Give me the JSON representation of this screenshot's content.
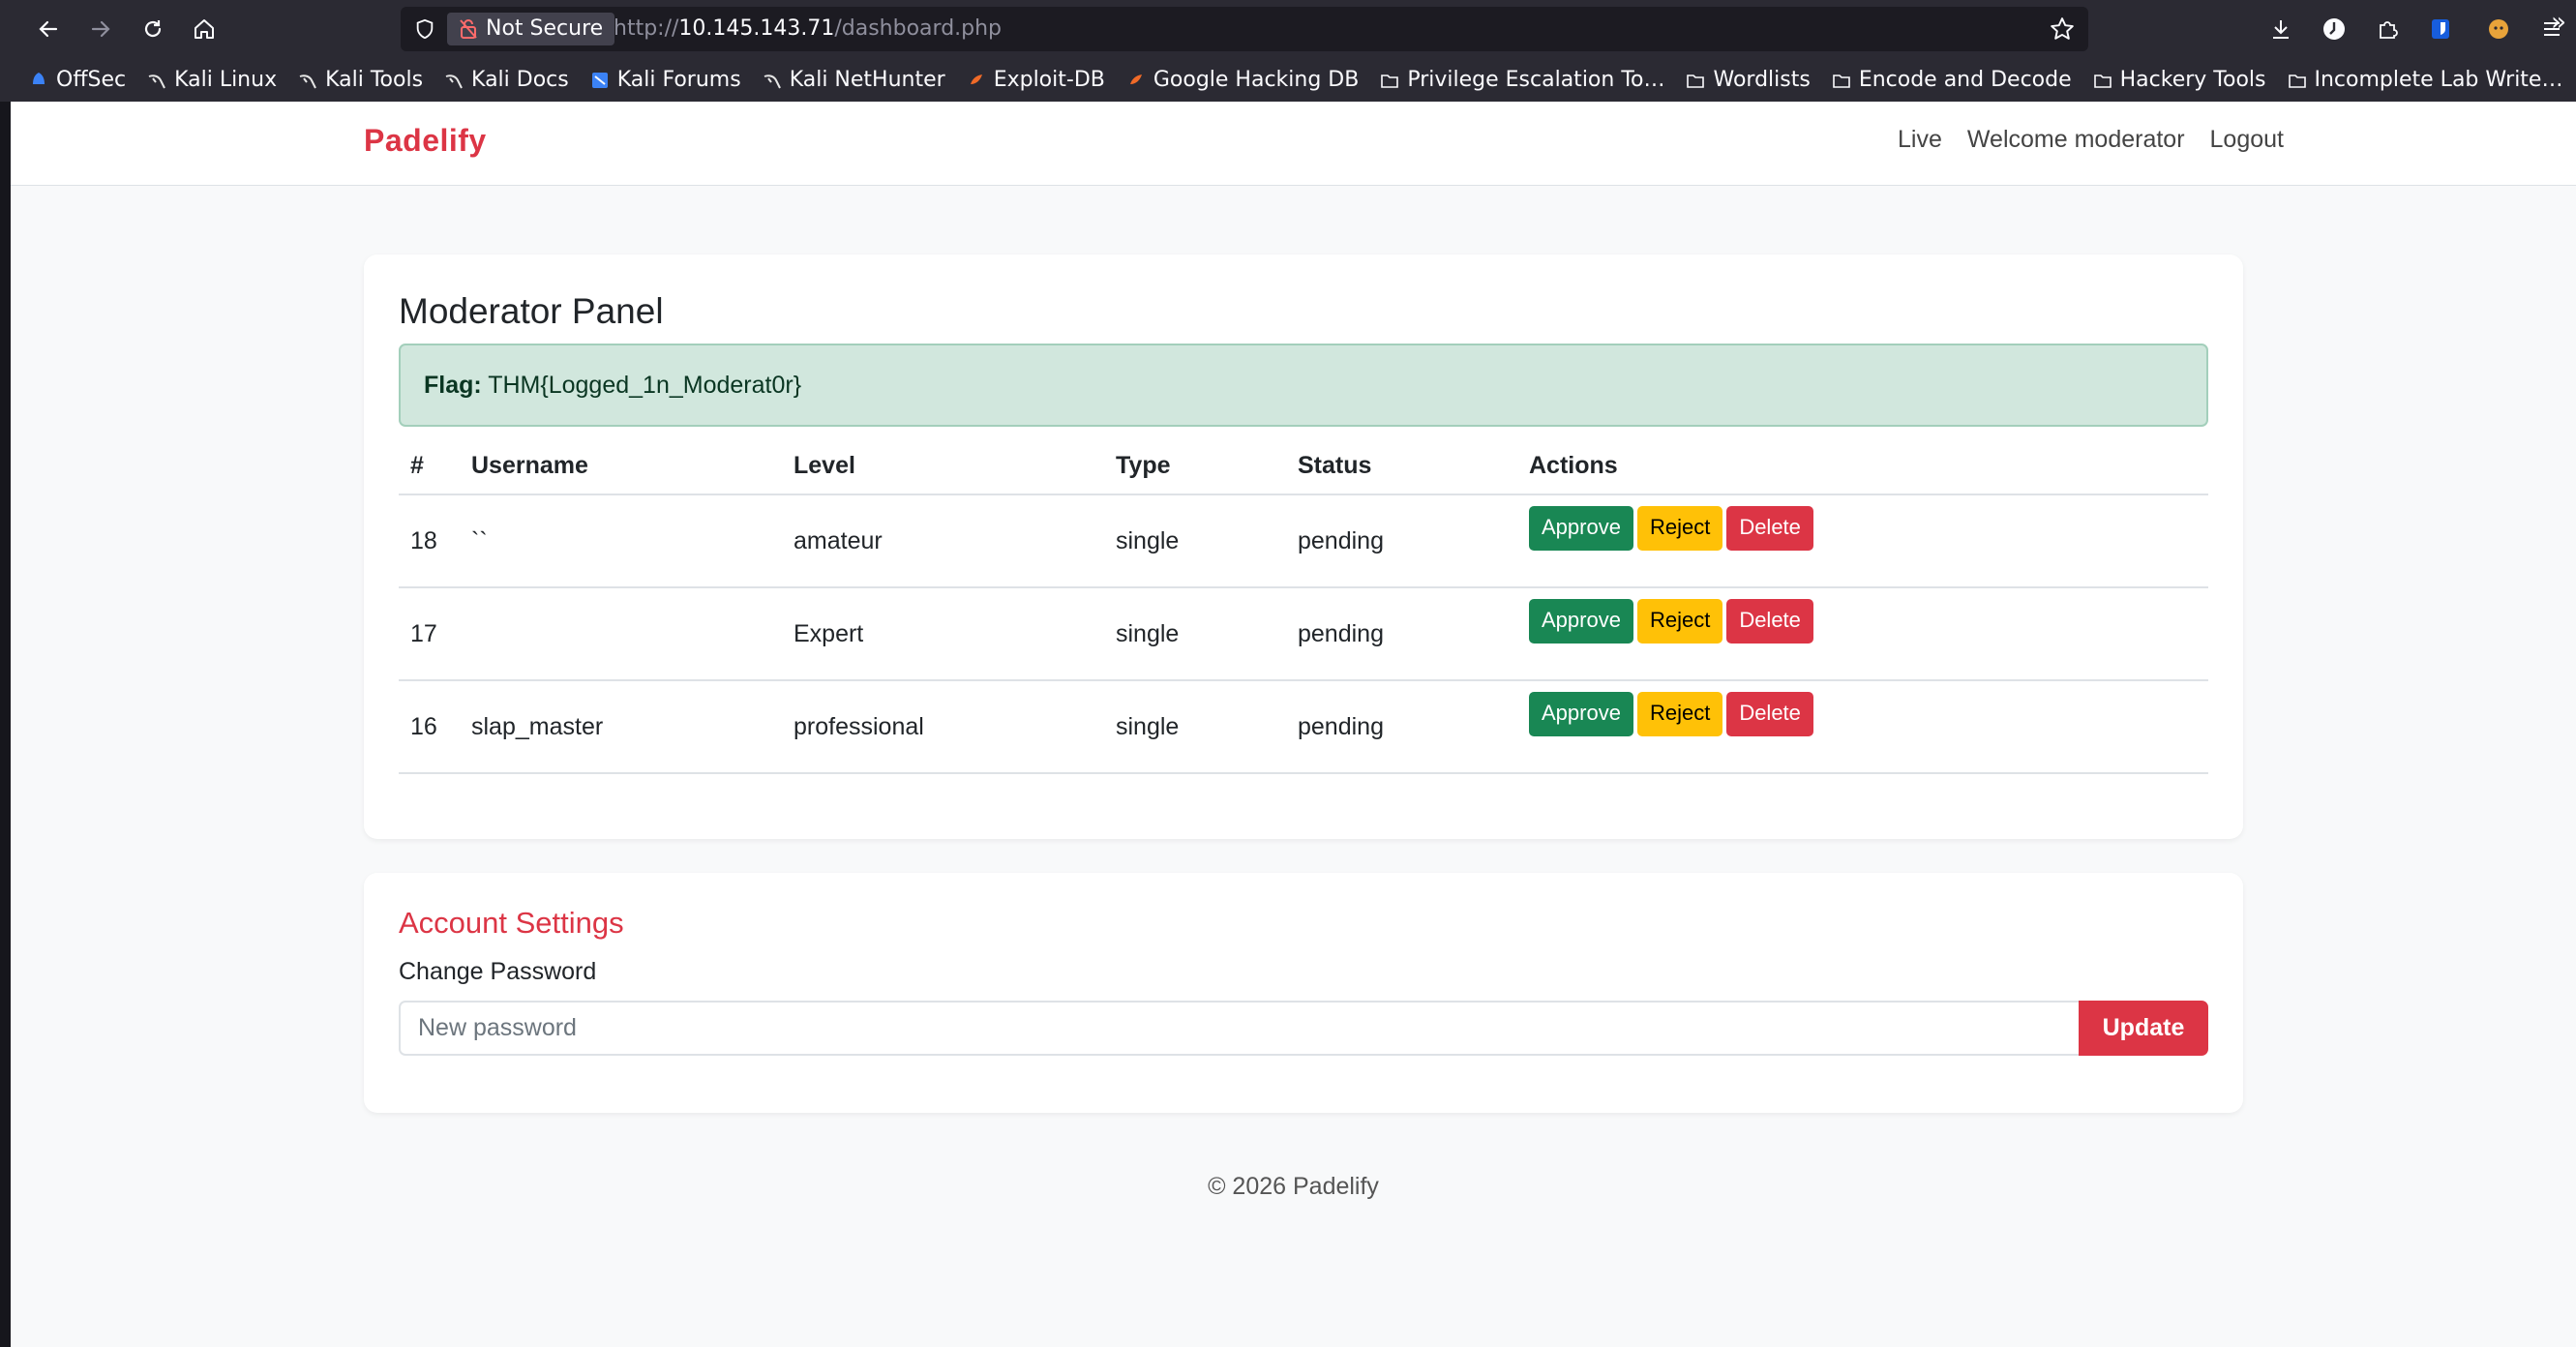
{
  "browser": {
    "security_label": "Not Secure",
    "url_prefix": "http://",
    "url_host": "10.145.143.71",
    "url_path": "/dashboard.php",
    "bookmarks": [
      {
        "label": "OffSec",
        "icon": "offsec-icon"
      },
      {
        "label": "Kali Linux",
        "icon": "kali-dragon-icon"
      },
      {
        "label": "Kali Tools",
        "icon": "kali-dragon-icon"
      },
      {
        "label": "Kali Docs",
        "icon": "kali-dragon-icon"
      },
      {
        "label": "Kali Forums",
        "icon": "kali-forums-icon"
      },
      {
        "label": "Kali NetHunter",
        "icon": "kali-dragon-icon"
      },
      {
        "label": "Exploit-DB",
        "icon": "exploitdb-icon"
      },
      {
        "label": "Google Hacking DB",
        "icon": "exploitdb-icon"
      },
      {
        "label": "Privilege Escalation To…",
        "icon": "folder-icon"
      },
      {
        "label": "Wordlists",
        "icon": "folder-icon"
      },
      {
        "label": "Encode and Decode",
        "icon": "folder-icon"
      },
      {
        "label": "Hackery Tools",
        "icon": "folder-icon"
      },
      {
        "label": "Incomplete Lab Write…",
        "icon": "folder-icon"
      }
    ]
  },
  "nav": {
    "brand": "Padelify",
    "live": "Live",
    "welcome": "Welcome moderator",
    "logout": "Logout"
  },
  "panel": {
    "title": "Moderator Panel",
    "flag_label": "Flag:",
    "flag_value": "THM{Logged_1n_Moderat0r}",
    "columns": [
      "#",
      "Username",
      "Level",
      "Type",
      "Status",
      "Actions"
    ],
    "rows": [
      {
        "id": "18",
        "username": "``",
        "level": "amateur",
        "type": "single",
        "status": "pending"
      },
      {
        "id": "17",
        "username": "",
        "level": "Expert",
        "type": "single",
        "status": "pending"
      },
      {
        "id": "16",
        "username": "slap_master",
        "level": "professional",
        "type": "single",
        "status": "pending"
      }
    ],
    "actions": {
      "approve": "Approve",
      "reject": "Reject",
      "delete": "Delete"
    }
  },
  "account": {
    "title": "Account Settings",
    "change_password_label": "Change Password",
    "password_placeholder": "New password",
    "update_label": "Update"
  },
  "footer": "© 2026 Padelify",
  "colors": {
    "brand": "#dc3545",
    "approve": "#198754",
    "reject": "#ffc107",
    "delete": "#dc3545",
    "flag_bg": "#d1e7dd"
  }
}
